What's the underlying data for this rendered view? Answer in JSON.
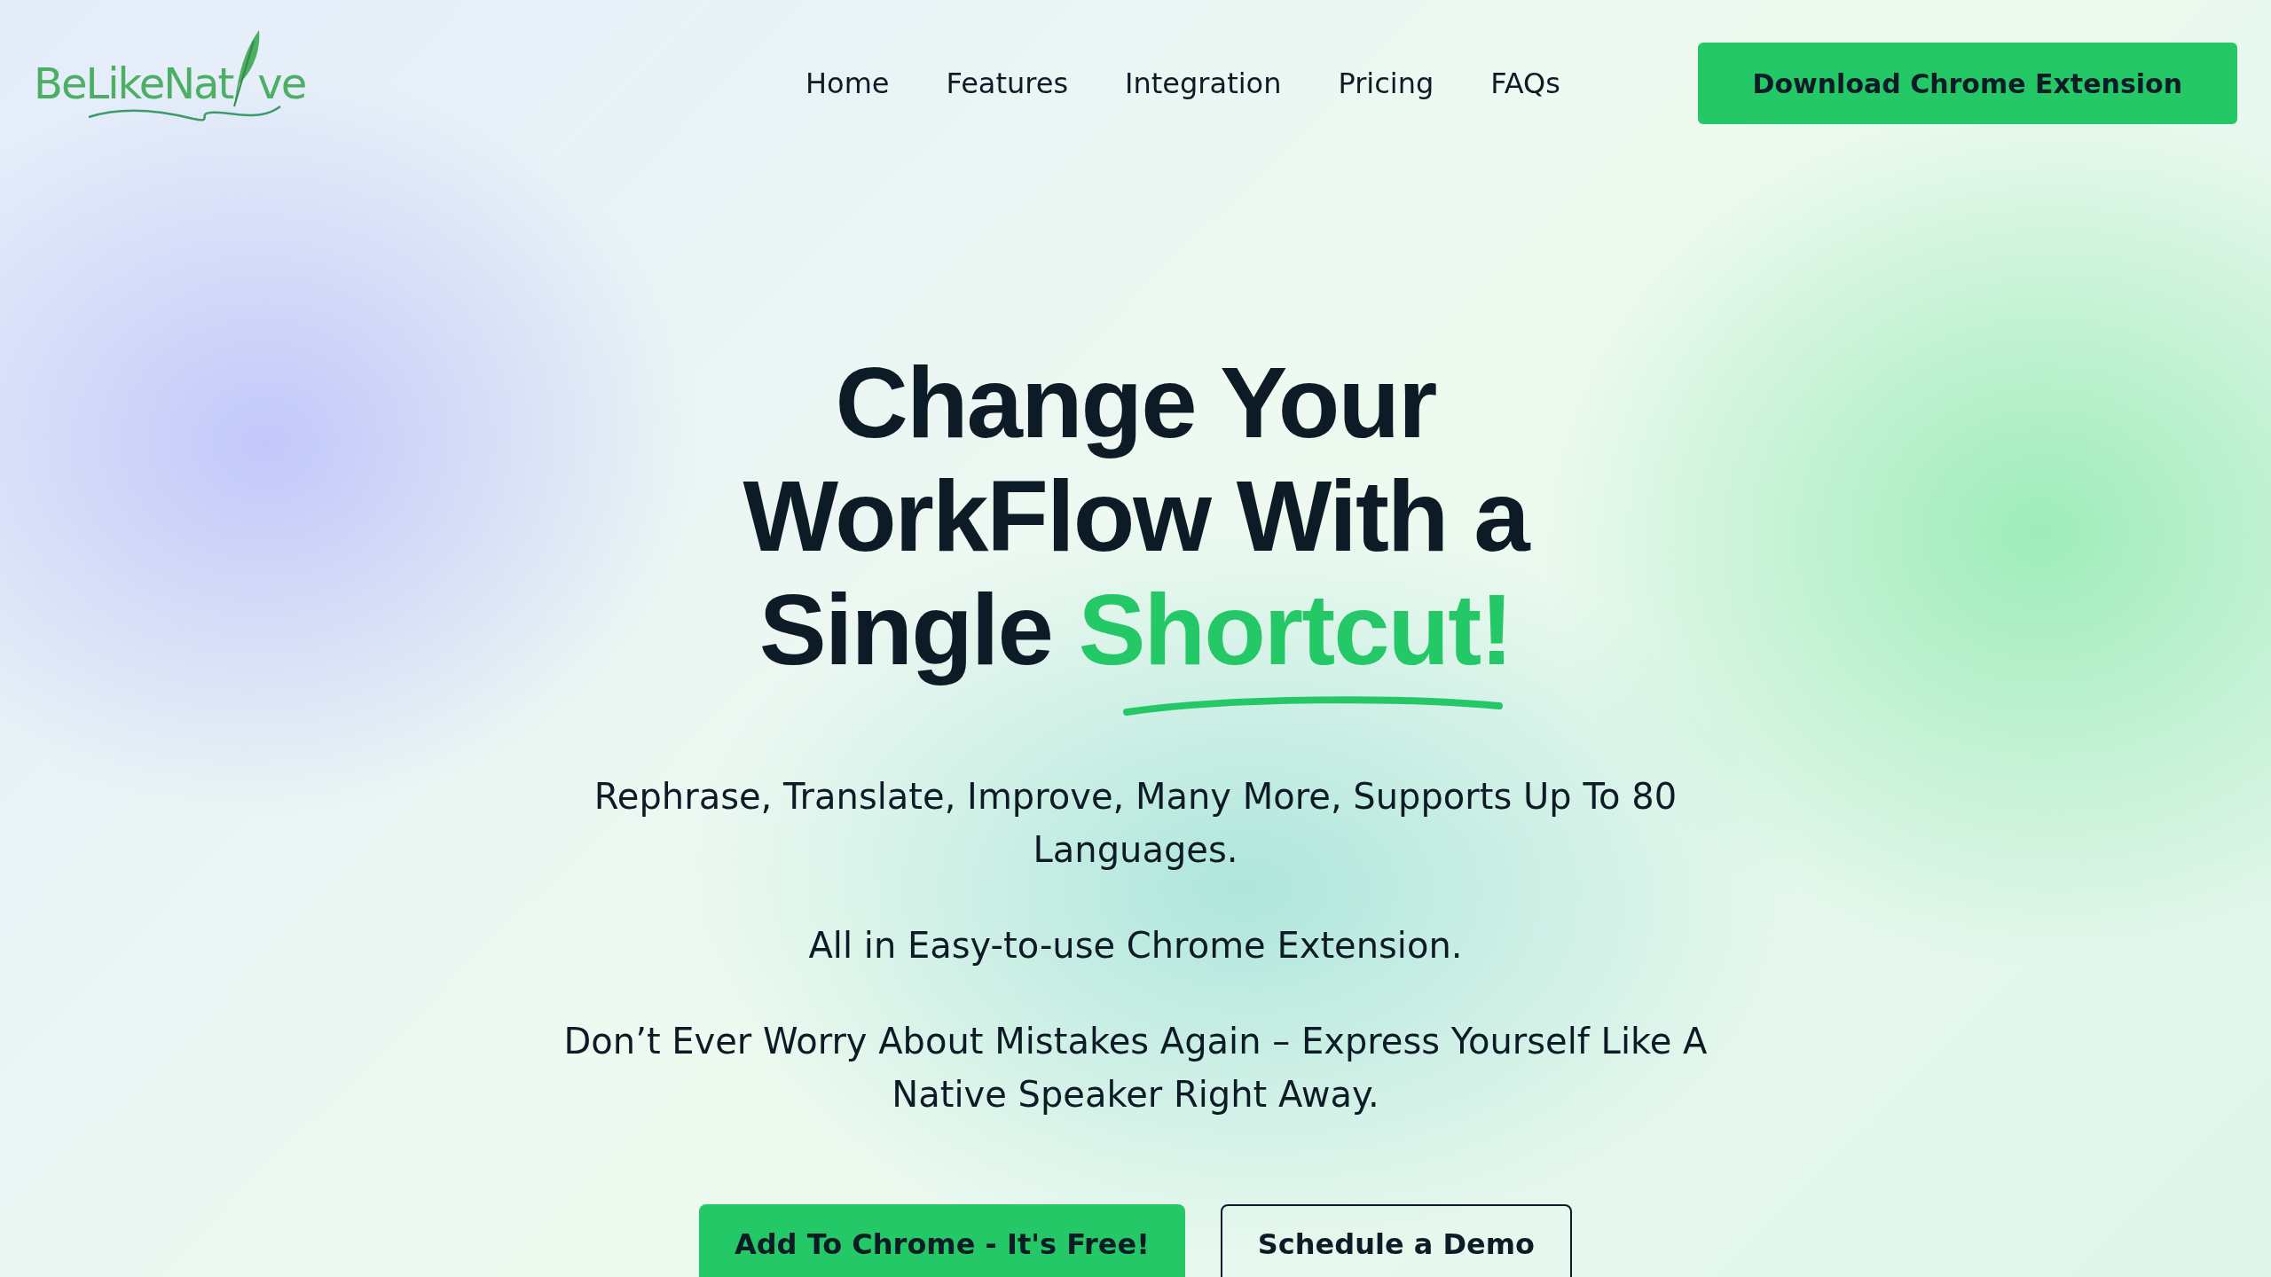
{
  "logo": {
    "text_start": "BeLikeNat",
    "text_end": "ve"
  },
  "nav": [
    {
      "label": "Home"
    },
    {
      "label": "Features"
    },
    {
      "label": "Integration"
    },
    {
      "label": "Pricing"
    },
    {
      "label": "FAQs"
    }
  ],
  "header_button": "Download Chrome Extension",
  "hero": {
    "headline_lines": [
      "Change Your",
      "WorkFlow With a",
      "Single"
    ],
    "highlight": "Shortcut!",
    "paragraphs": [
      "Rephrase, Translate, Improve, Many More, Supports Up To 80 Languages.",
      "All in Easy-to-use Chrome Extension.",
      "Don’t Ever Worry About Mistakes Again – Express Yourself Like A Native Speaker Right Away."
    ],
    "buttons": [
      {
        "label": "Add To Chrome - It's Free!",
        "kind": "primary"
      },
      {
        "label": "Schedule a Demo",
        "kind": "outline"
      }
    ]
  }
}
